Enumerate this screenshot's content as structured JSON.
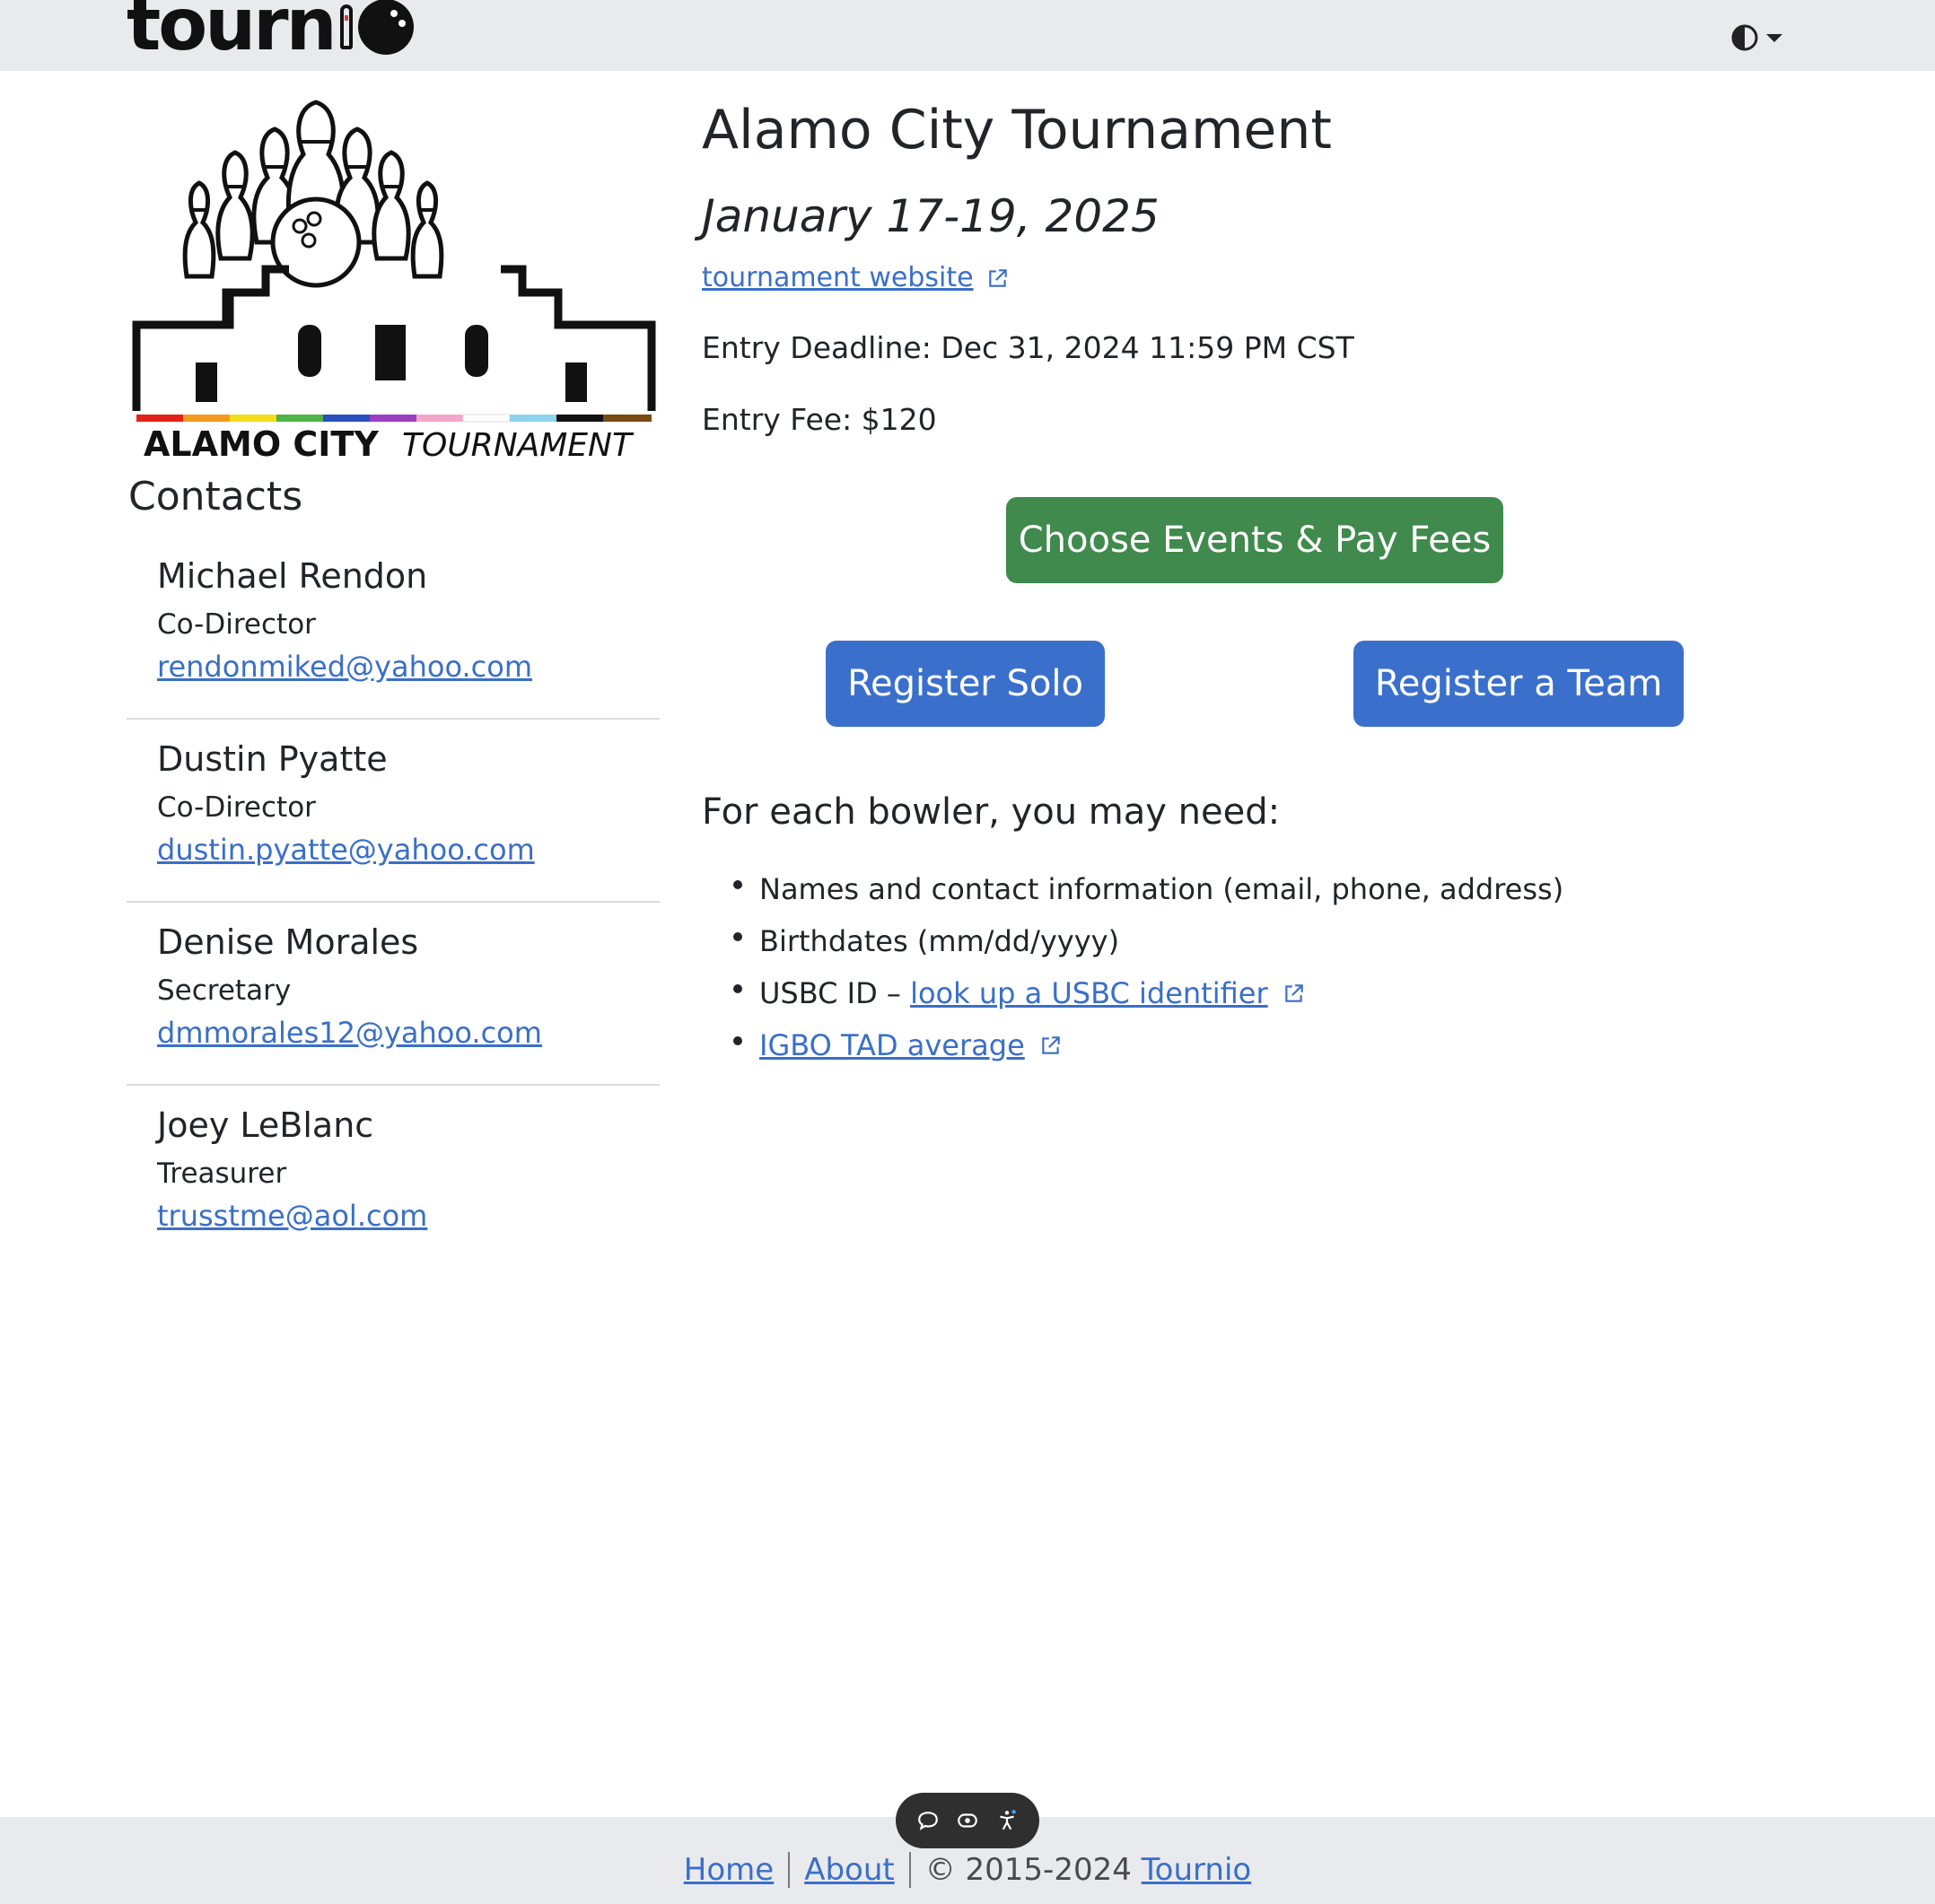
{
  "header": {
    "brand": "tourn",
    "theme_toggle_icon": "contrast-icon"
  },
  "logo": {
    "word_bold": "ALAMO CITY",
    "word_light": "TOURNAMENT",
    "stripe_colors": [
      "#e4211a",
      "#f29a1d",
      "#f4dd1a",
      "#4fb348",
      "#2a4fbf",
      "#9b3fc2",
      "#f3a6c8",
      "#ffffff",
      "#8dd3ec",
      "#111111",
      "#7a4a14"
    ]
  },
  "contacts": {
    "title": "Contacts",
    "items": [
      {
        "name": "Michael Rendon",
        "role": "Co-Director",
        "email": "rendonmiked@yahoo.com"
      },
      {
        "name": "Dustin Pyatte",
        "role": "Co-Director",
        "email": "dustin.pyatte@yahoo.com"
      },
      {
        "name": "Denise Morales",
        "role": "Secretary",
        "email": "dmmorales12@yahoo.com"
      },
      {
        "name": "Joey LeBlanc",
        "role": "Treasurer",
        "email": "trusstme@aol.com"
      }
    ]
  },
  "tournament": {
    "title": "Alamo City Tournament",
    "dates": "January 17-19, 2025",
    "website_link": "tournament website",
    "deadline": "Entry Deadline: Dec 31, 2024 11:59 PM CST",
    "fee": "Entry Fee: $120"
  },
  "actions": {
    "choose_events": "Choose Events & Pay Fees",
    "register_solo": "Register Solo",
    "register_team": "Register a Team"
  },
  "needs": {
    "title": "For each bowler, you may need:",
    "item1": "Names and contact information (email, phone, address)",
    "item2": "Birthdates (mm/dd/yyyy)",
    "item3_prefix": "USBC ID – ",
    "item3_link": "look up a USBC identifier",
    "item4_link": "IGBO TAD average"
  },
  "footer": {
    "home": "Home",
    "about": "About",
    "copyright": "© 2015-2024 ",
    "tournio": "Tournio"
  },
  "colors": {
    "link": "#3a6fc8",
    "primary": "#3a70cc",
    "success": "#3f8a4c",
    "navbar": "#e9eaee"
  }
}
